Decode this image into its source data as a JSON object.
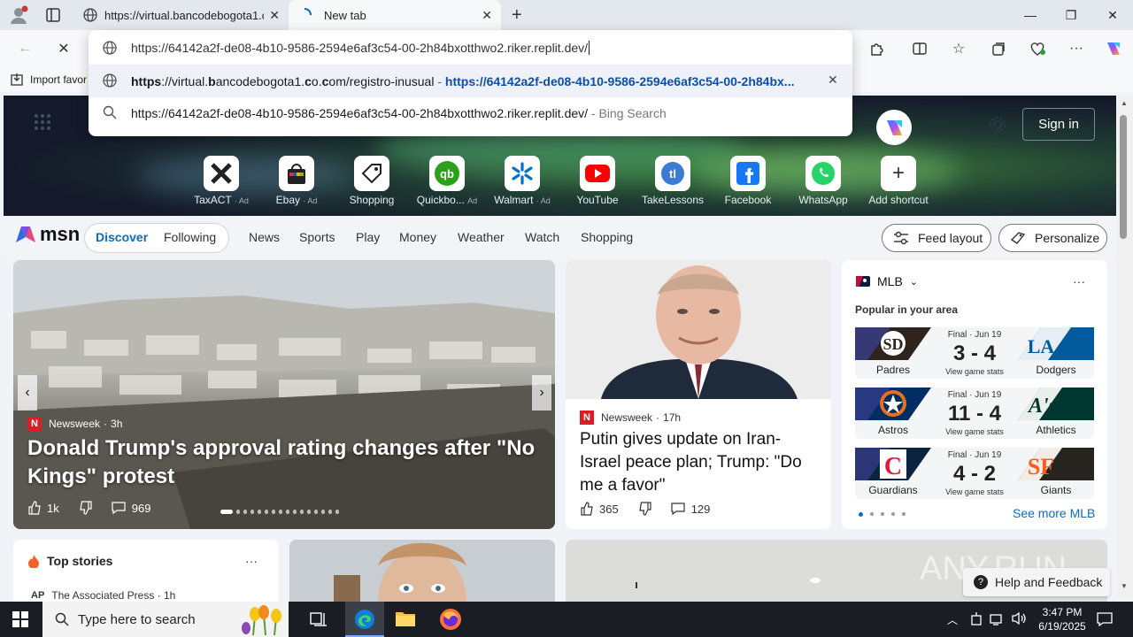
{
  "browser": {
    "tabs": [
      {
        "title": "https://virtual.bancodebogota1.co",
        "state": "inactive"
      },
      {
        "title": "New tab",
        "state": "active"
      }
    ],
    "address_value": "https://64142a2f-de08-4b10-9586-2594e6af3c54-00-2h84bxotthwo2.riker.replit.dev/",
    "suggestions": [
      {
        "prefix_bold": "https",
        "text1": "://virtual.",
        "bold2": "b",
        "text2": "ancodebogota1.",
        "bold3": "c",
        "text3": "o.",
        "bold4": "c",
        "text4": "om/registro-inusual",
        "separator": " - ",
        "url": "https://64142a2f-de08-4b10-9586-2594e6af3c54-00-2h84bx..."
      },
      {
        "text": "https://64142a2f-de08-4b10-9586-2594e6af3c54-00-2h84bxotthwo2.riker.replit.dev/",
        "suffix": " - Bing Search"
      }
    ],
    "favorites": {
      "import_label": "Import favor"
    }
  },
  "newtab": {
    "sign_in": "Sign in",
    "tiles": [
      {
        "label": "TaxACT",
        "ad": "· Ad"
      },
      {
        "label": "Ebay",
        "ad": "· Ad"
      },
      {
        "label": "Shopping",
        "ad": ""
      },
      {
        "label": "Quickbo...",
        "ad": "Ad"
      },
      {
        "label": "Walmart",
        "ad": "· Ad"
      },
      {
        "label": "YouTube",
        "ad": ""
      },
      {
        "label": "TakeLessons",
        "ad": ""
      },
      {
        "label": "Facebook",
        "ad": ""
      },
      {
        "label": "WhatsApp",
        "ad": ""
      },
      {
        "label": "Add shortcut",
        "ad": ""
      }
    ]
  },
  "msn": {
    "logo": "msn",
    "nav": [
      "Discover",
      "Following",
      "News",
      "Sports",
      "Play",
      "Money",
      "Weather",
      "Watch",
      "Shopping"
    ],
    "feed_layout": "Feed layout",
    "personalize": "Personalize"
  },
  "hero_story": {
    "source": "Newsweek",
    "age": "3h",
    "headline": "Donald Trump's approval rating changes after \"No Kings\" protest",
    "likes": "1k",
    "comments": "969"
  },
  "putin_story": {
    "source": "Newsweek",
    "age": "17h",
    "headline": "Putin gives update on Iran-Israel peace plan; Trump: \"Do me a favor\"",
    "likes": "365",
    "comments": "129"
  },
  "mlb": {
    "title": "MLB",
    "subtitle": "Popular in your area",
    "games": [
      {
        "status": "Final · Jun 19",
        "home": "Padres",
        "away": "Dodgers",
        "score": "3 - 4",
        "stats": "View game stats",
        "home_color": "#2f241d",
        "away_color": "#005a9c"
      },
      {
        "status": "Final · Jun 19",
        "home": "Astros",
        "away": "Athletics",
        "score": "11 - 4",
        "stats": "View game stats",
        "home_color": "#002d62",
        "away_color": "#003831"
      },
      {
        "status": "Final · Jun 19",
        "home": "Guardians",
        "away": "Giants",
        "score": "4 - 2",
        "stats": "View game stats",
        "home_color": "#0c2340",
        "away_color": "#27251f"
      }
    ],
    "see_more": "See more MLB"
  },
  "top_stories": {
    "title": "Top stories",
    "source": "The Associated Press · 1h"
  },
  "feedback": "Help and Feedback",
  "taskbar": {
    "search_placeholder": "Type here to search",
    "time": "3:47 PM",
    "date": "6/19/2025"
  }
}
